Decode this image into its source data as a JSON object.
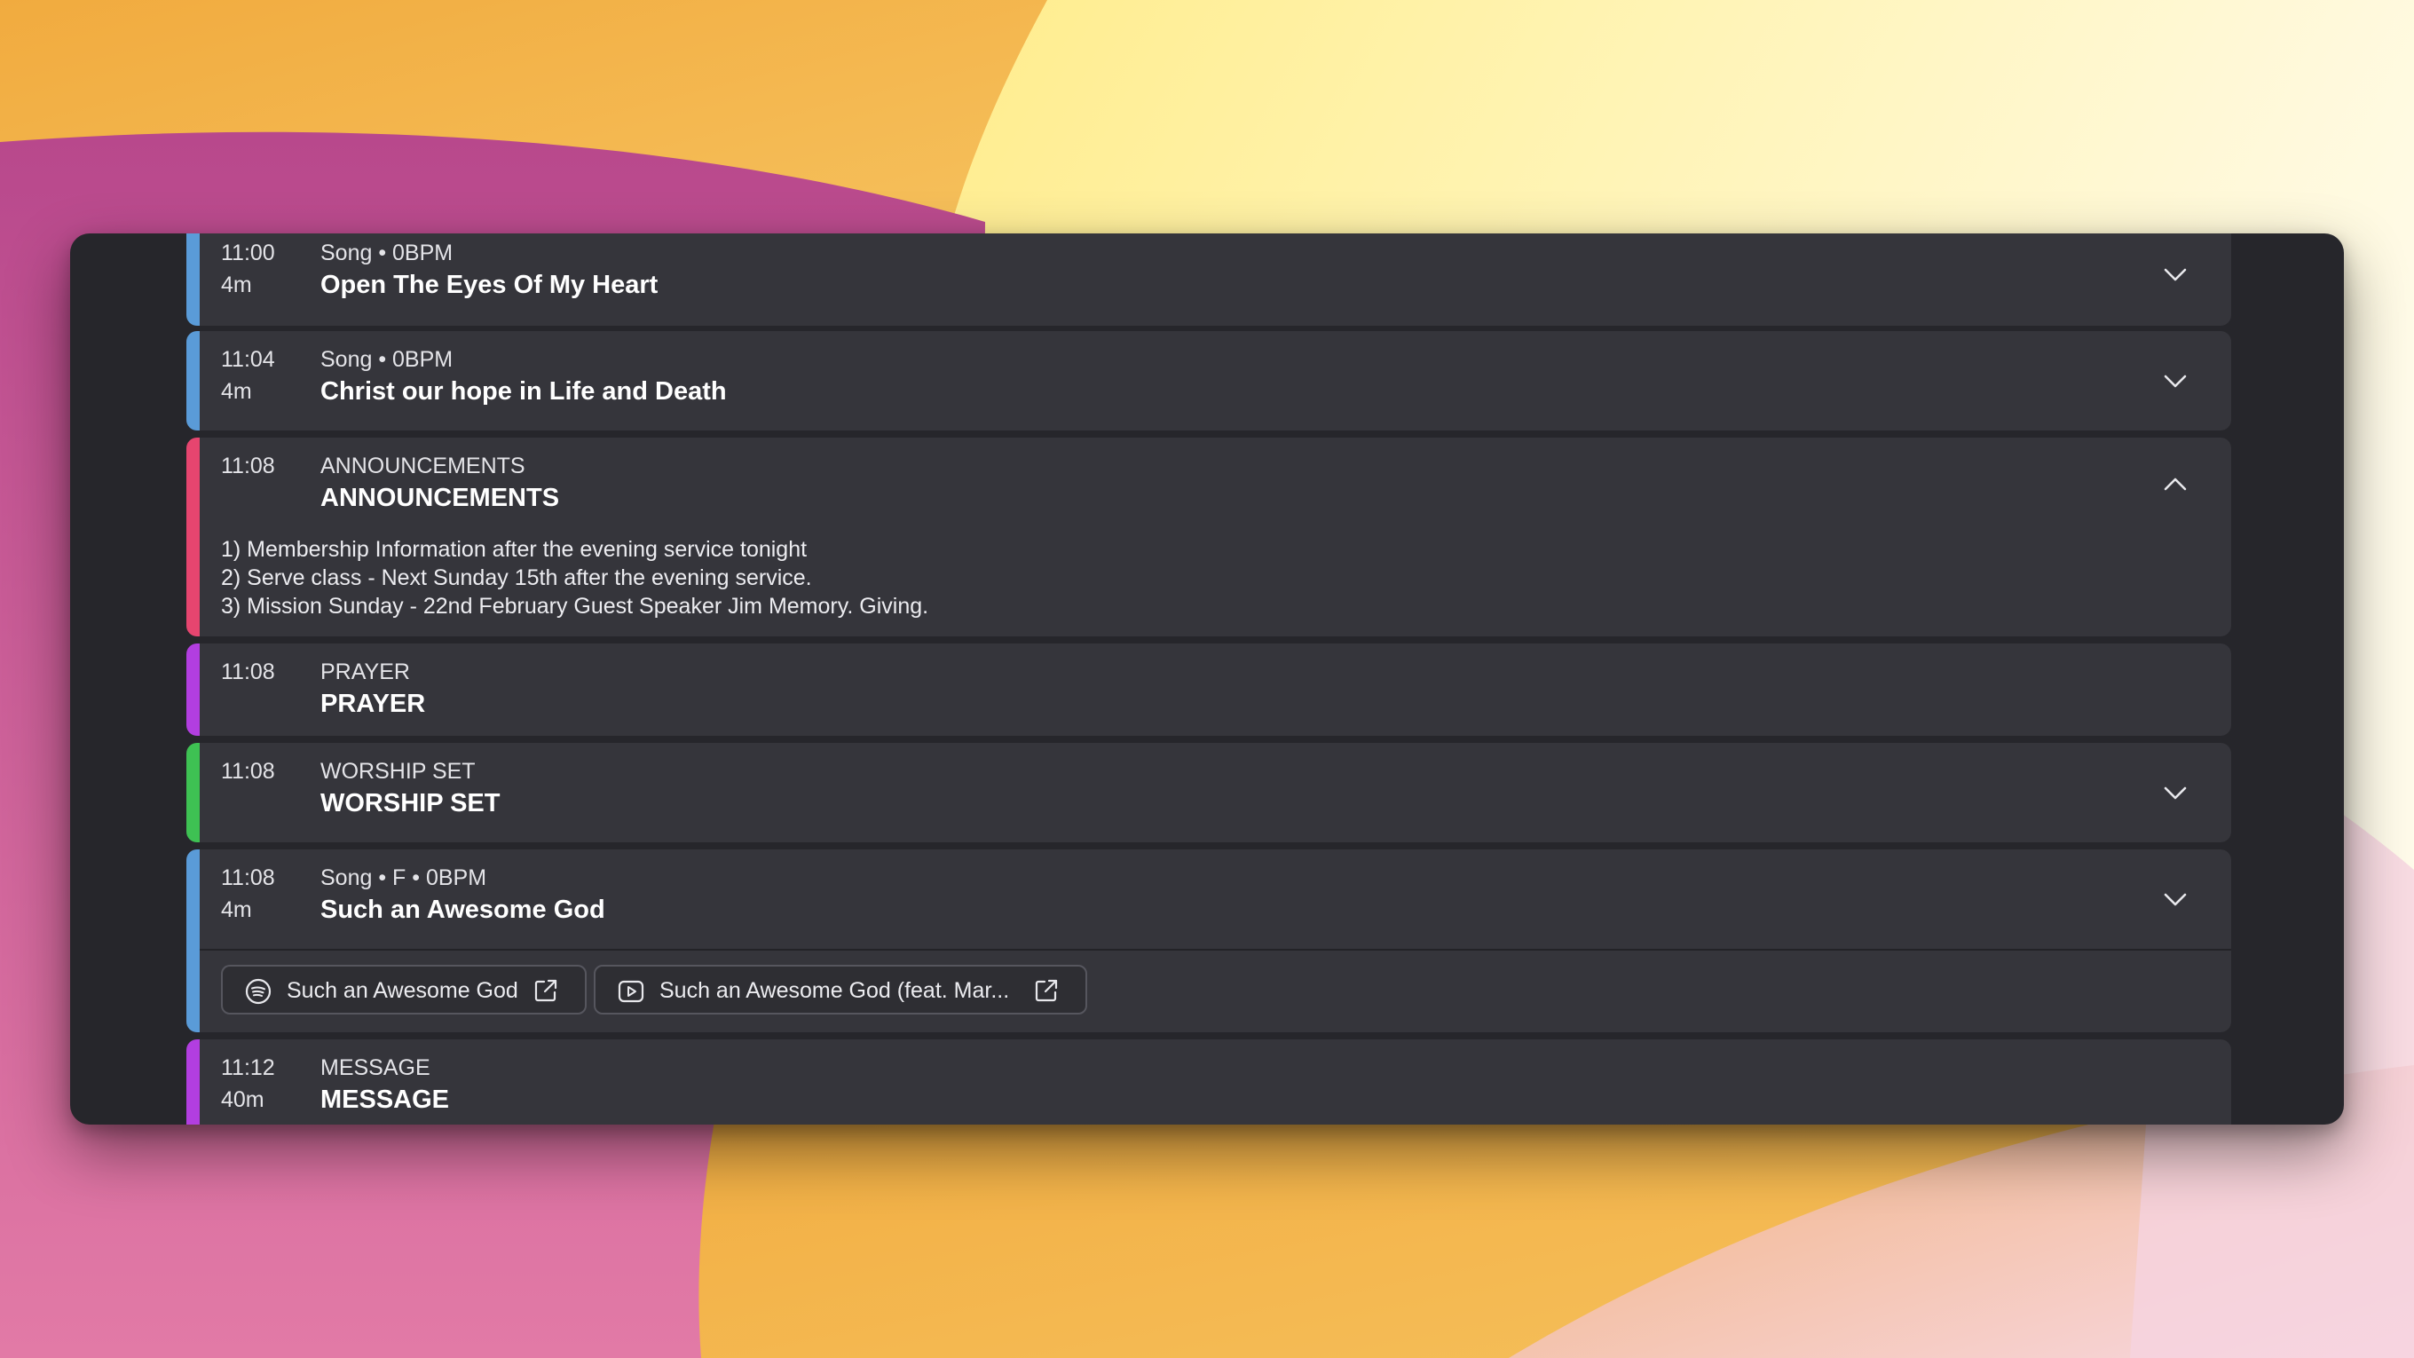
{
  "colors": {
    "song": "#5a9bd8",
    "announcements": "#e6456f",
    "prayer": "#b23ee0",
    "worship_set": "#3ec153",
    "message": "#b23ee0",
    "item_bg": "#35353b",
    "window_bg": "#26262b"
  },
  "items": [
    {
      "time": "11:00",
      "duration": "4m",
      "subtitle": "Song • 0BPM",
      "title": "Open The Eyes Of My Heart",
      "toggle_icon": "chevron-down-icon"
    },
    {
      "time": "11:04",
      "duration": "4m",
      "subtitle": "Song • 0BPM",
      "title": "Christ our hope in Life and Death",
      "toggle_icon": "chevron-down-icon"
    },
    {
      "time": "11:08",
      "duration": "",
      "subtitle": "ANNOUNCEMENTS",
      "title": "ANNOUNCEMENTS",
      "toggle_icon": "chevron-up-icon",
      "notes": [
        "1) Membership Information after the evening service tonight",
        "2) Serve class - Next Sunday 15th after the evening service.",
        "3) Mission Sunday - 22nd February Guest Speaker Jim Memory. Giving."
      ]
    },
    {
      "time": "11:08",
      "duration": "",
      "subtitle": "PRAYER",
      "title": "PRAYER"
    },
    {
      "time": "11:08",
      "duration": "",
      "subtitle": "WORSHIP SET",
      "title": "WORSHIP SET",
      "toggle_icon": "chevron-down-icon"
    },
    {
      "time": "11:08",
      "duration": "4m",
      "subtitle": "Song • F • 0BPM",
      "title": "Such an Awesome God",
      "toggle_icon": "chevron-down-icon",
      "links": [
        {
          "label": "Such an Awesome God",
          "icon": "spotify-icon",
          "action_icon": "external-link-icon"
        },
        {
          "label": "Such an Awesome God (feat. Mar...",
          "icon": "youtube-icon",
          "action_icon": "external-link-icon"
        }
      ]
    },
    {
      "time": "11:12",
      "duration": "40m",
      "subtitle": "MESSAGE",
      "title": "MESSAGE"
    }
  ]
}
